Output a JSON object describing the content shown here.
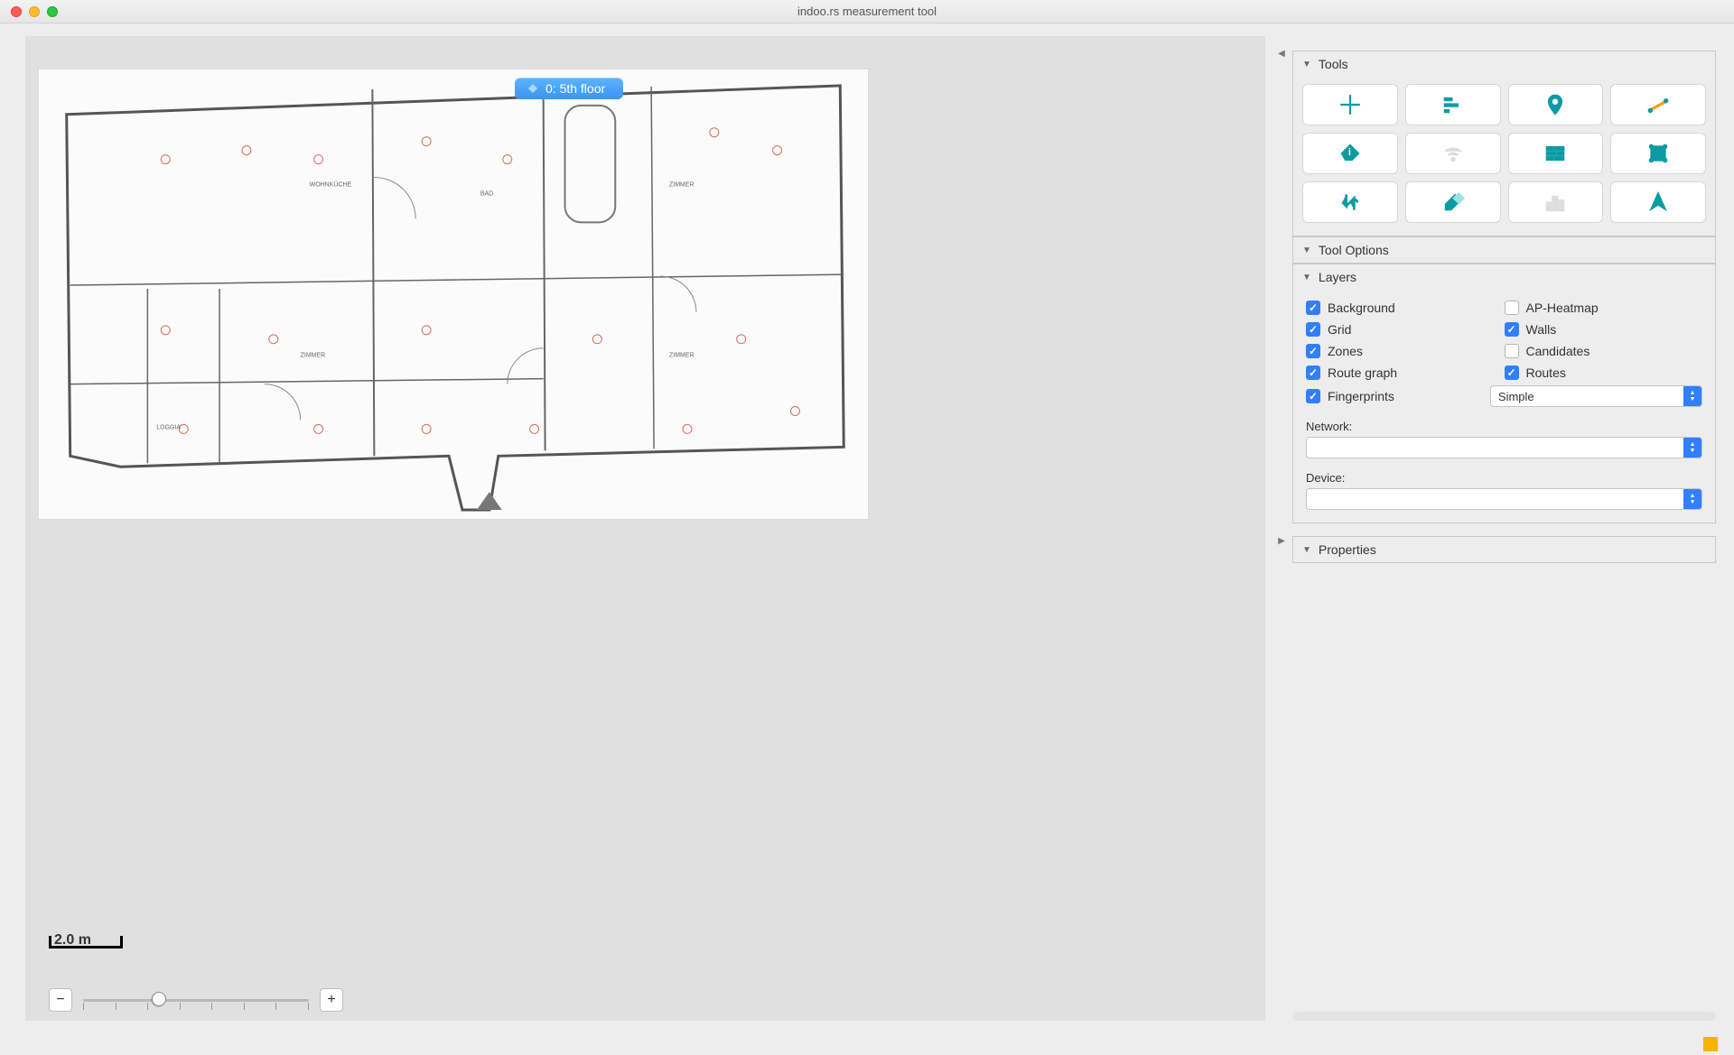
{
  "window": {
    "title": "indoo.rs measurement tool"
  },
  "floor_tab": {
    "label": "0: 5th floor"
  },
  "scale": {
    "label": "2.0 m"
  },
  "panels": {
    "tools": {
      "title": "Tools",
      "items": [
        {
          "name": "crosshair",
          "enabled": true
        },
        {
          "name": "align",
          "enabled": true
        },
        {
          "name": "pin",
          "enabled": true
        },
        {
          "name": "measure-line",
          "enabled": true
        },
        {
          "name": "info-tag",
          "enabled": true
        },
        {
          "name": "wifi",
          "enabled": false
        },
        {
          "name": "wall",
          "enabled": true
        },
        {
          "name": "crop",
          "enabled": true
        },
        {
          "name": "swap",
          "enabled": true
        },
        {
          "name": "eraser",
          "enabled": true
        },
        {
          "name": "city",
          "enabled": false
        },
        {
          "name": "nav-arrow",
          "enabled": true
        }
      ]
    },
    "tool_options": {
      "title": "Tool Options"
    },
    "layers": {
      "title": "Layers",
      "items": [
        {
          "label": "Background",
          "checked": true
        },
        {
          "label": "AP-Heatmap",
          "checked": false
        },
        {
          "label": "Grid",
          "checked": true
        },
        {
          "label": "Walls",
          "checked": true
        },
        {
          "label": "Zones",
          "checked": true
        },
        {
          "label": "Candidates",
          "checked": false
        },
        {
          "label": "Route graph",
          "checked": true
        },
        {
          "label": "Routes",
          "checked": true
        },
        {
          "label": "Fingerprints",
          "checked": true
        }
      ],
      "fingerprint_mode": "Simple",
      "network_label": "Network:",
      "network_value": "",
      "device_label": "Device:",
      "device_value": ""
    },
    "properties": {
      "title": "Properties"
    }
  }
}
